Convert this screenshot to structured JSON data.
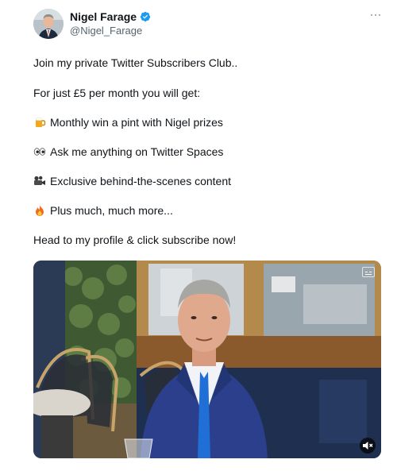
{
  "author": {
    "name": "Nigel Farage",
    "handle": "@Nigel_Farage",
    "verified": true
  },
  "icons": {
    "more": "more-options-icon",
    "verified": "verified-badge-icon",
    "mute": "mute-icon",
    "captions": "captions-icon"
  },
  "body": {
    "line1": "Join my private Twitter Subscribers Club..",
    "line2": "For just £5 per month you will get:",
    "bullets": [
      {
        "emoji": "beer-mug",
        "text": "Monthly win a pint with Nigel prizes"
      },
      {
        "emoji": "eyes",
        "text": "Ask me anything on Twitter Spaces"
      },
      {
        "emoji": "movie-camera",
        "text": "Exclusive behind-the-scenes content"
      },
      {
        "emoji": "fire",
        "text": "Plus much, much more..."
      }
    ],
    "cta": "Head to my profile & click subscribe now!"
  },
  "colors": {
    "verified": "#1d9bf0",
    "text": "#0f1419",
    "secondary": "#536471",
    "suit": "#2b3f8c",
    "tie": "#1f6fd6"
  }
}
